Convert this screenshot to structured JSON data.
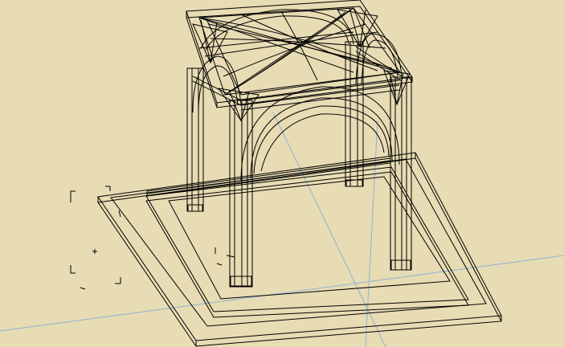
{
  "viewport": {
    "background_color": "#e8dcb4",
    "wire_color": "#000000",
    "grid_axis_color": "#8cb4d2"
  }
}
